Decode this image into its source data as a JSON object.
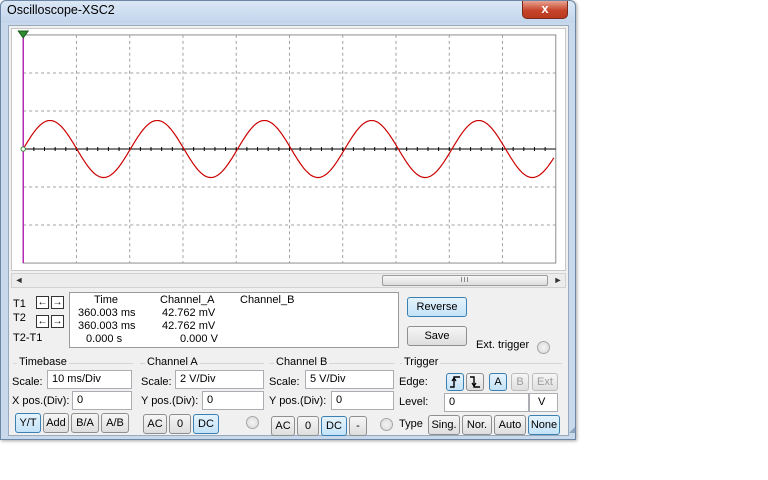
{
  "window": {
    "title": "Oscilloscope-XSC2",
    "close_label": "x"
  },
  "screen": {
    "background": "#ffffff",
    "grid_color": "#a0a0a0",
    "axis_color": "#000000",
    "trace_color": "#cc0000",
    "cursor_color": "#b000b0",
    "scrollbar_grip": "III",
    "scroll_left": "◄",
    "scroll_right": "►"
  },
  "cursors": {
    "t1_label": "T1",
    "t2_label": "T2",
    "t2t1_label": "T2-T1",
    "left_arrow": "←",
    "right_arrow": "→"
  },
  "readout": {
    "headers": [
      "Time",
      "Channel_A",
      "Channel_B"
    ],
    "t1": {
      "time": "360.003 ms",
      "channel_a": "42.762 mV",
      "channel_b": ""
    },
    "t2": {
      "time": "360.003 ms",
      "channel_a": "42.762 mV",
      "channel_b": ""
    },
    "t2t1": {
      "time": "0.000 s",
      "channel_a": "0.000 V",
      "channel_b": ""
    }
  },
  "actions": {
    "reverse_label": "Reverse",
    "save_label": "Save",
    "ext_trigger_label": "Ext. trigger"
  },
  "timebase": {
    "title": "Timebase",
    "scale_label": "Scale:",
    "scale_value": "10 ms/Div",
    "xpos_label": "X pos.(Div):",
    "xpos_value": "0",
    "buttons": [
      "Y/T",
      "Add",
      "B/A",
      "A/B"
    ],
    "active": "Y/T"
  },
  "channel_a": {
    "title": "Channel A",
    "scale_label": "Scale:",
    "scale_value": "2  V/Div",
    "ypos_label": "Y pos.(Div):",
    "ypos_value": "0",
    "buttons": [
      "AC",
      "0",
      "DC"
    ],
    "active": "DC"
  },
  "channel_b": {
    "title": "Channel B",
    "scale_label": "Scale:",
    "scale_value": "5  V/Div",
    "ypos_label": "Y pos.(Div):",
    "ypos_value": "0",
    "buttons": [
      "AC",
      "0",
      "DC",
      "-"
    ],
    "active": "DC"
  },
  "trigger": {
    "title": "Trigger",
    "edge_label": "Edge:",
    "edge_buttons": [
      "rising-edge-icon",
      "falling-edge-icon"
    ],
    "source_buttons": [
      "A",
      "B",
      "Ext"
    ],
    "active_source": "A",
    "level_label": "Level:",
    "level_value": "0",
    "level_unit": "V",
    "type_label": "Type",
    "type_buttons": [
      "Sing.",
      "Nor.",
      "Auto",
      "None"
    ],
    "active_type": "None"
  }
}
